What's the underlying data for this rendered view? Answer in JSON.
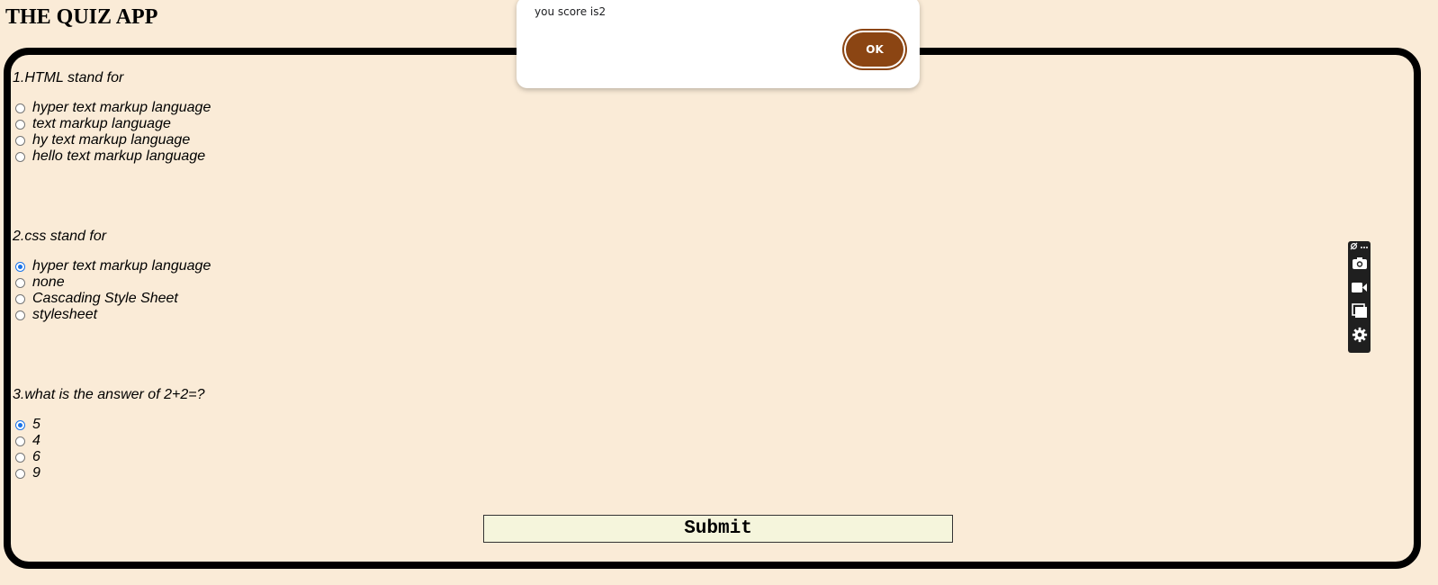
{
  "app": {
    "title": "THE QUIZ APP"
  },
  "questions": [
    {
      "text": "1.HTML stand for",
      "options": [
        {
          "label": "hyper text markup language",
          "selected": false
        },
        {
          "label": "text markup language",
          "selected": false
        },
        {
          "label": "hy text markup language",
          "selected": false
        },
        {
          "label": "hello text markup language",
          "selected": false
        }
      ]
    },
    {
      "text": "2.css stand for",
      "options": [
        {
          "label": "hyper text markup language",
          "selected": true
        },
        {
          "label": "none",
          "selected": false
        },
        {
          "label": "Cascading Style Sheet",
          "selected": false
        },
        {
          "label": "stylesheet",
          "selected": false
        }
      ]
    },
    {
      "text": "3.what is the answer of 2+2=?",
      "options": [
        {
          "label": "5",
          "selected": true
        },
        {
          "label": "4",
          "selected": false
        },
        {
          "label": "6",
          "selected": false
        },
        {
          "label": "9",
          "selected": false
        }
      ]
    }
  ],
  "submit": {
    "label": "Submit"
  },
  "alert": {
    "message": "you score is2",
    "ok_label": "OK"
  },
  "toolbar": {
    "icons": [
      "pin-icon",
      "more-icon",
      "camera-icon",
      "video-icon",
      "window-capture-icon",
      "settings-icon"
    ]
  },
  "colors": {
    "background": "#faebd7",
    "frame_border": "#000000",
    "submit_bg": "#f5f5dc",
    "ok_button": "#8b4513",
    "radio_checked": "#1a73e8"
  }
}
